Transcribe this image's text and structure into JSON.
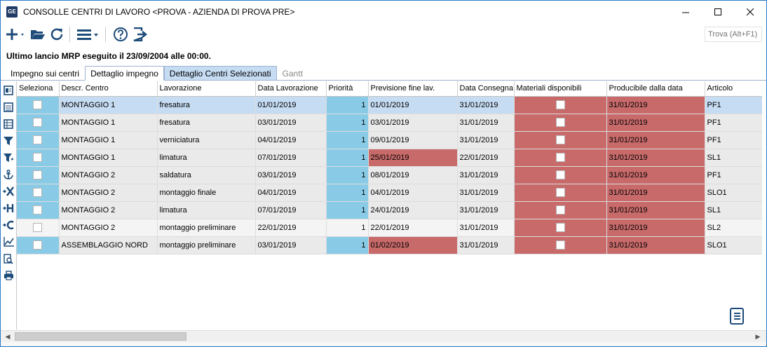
{
  "window": {
    "app_icon": "GE",
    "title": "CONSOLLE CENTRI DI LAVORO <PROVA - AZIENDA DI PROVA PRE>"
  },
  "toolbar": {
    "icons": [
      "plus-icon",
      "folder-open-icon",
      "refresh-icon",
      "menu-icon",
      "help-icon",
      "exit-icon"
    ],
    "search_placeholder": "Trova (Alt+F1)"
  },
  "status": {
    "mrp_line": "Ultimo lancio MRP eseguito il 23/09/2004 alle 00:00."
  },
  "tabs": [
    {
      "label": "Impegno sui centri",
      "state": "normal"
    },
    {
      "label": "Dettaglio impegno",
      "state": "active"
    },
    {
      "label": "Dettaglio Centri Selezionati",
      "state": "selected"
    },
    {
      "label": "Gantt",
      "state": "disabled"
    }
  ],
  "side_icons": [
    "form-icon",
    "list-icon",
    "table-icon",
    "filter-icon",
    "filter-plus-icon",
    "anchor-icon",
    "connect-x-icon",
    "connect-h-icon",
    "connect-c-icon",
    "chart-line-icon",
    "magnify-doc-icon",
    "print-icon"
  ],
  "grid": {
    "columns": [
      "Seleziona",
      "Descr. Centro",
      "Lavorazione",
      "Data Lavorazione",
      "Priorità",
      "Previsione fine lav.",
      "Data Consegna",
      "Materiali disponibili",
      "Producibile dalla data",
      "Articolo"
    ],
    "rows": [
      {
        "centro": "MONTAGGIO 1",
        "lavorazione": "fresatura",
        "data_lav": "01/01/2019",
        "priorita": "1",
        "previsione": "01/01/2019",
        "consegna": "31/01/2019",
        "producibile": "31/01/2019",
        "articolo": "PF1"
      },
      {
        "centro": "MONTAGGIO 1",
        "lavorazione": "fresatura",
        "data_lav": "03/01/2019",
        "priorita": "1",
        "previsione": "03/01/2019",
        "consegna": "31/01/2019",
        "producibile": "31/01/2019",
        "articolo": "PF1"
      },
      {
        "centro": "MONTAGGIO 1",
        "lavorazione": "verniciatura",
        "data_lav": "04/01/2019",
        "priorita": "1",
        "previsione": "09/01/2019",
        "consegna": "31/01/2019",
        "producibile": "31/01/2019",
        "articolo": "PF1"
      },
      {
        "centro": "MONTAGGIO 1",
        "lavorazione": "limatura",
        "data_lav": "07/01/2019",
        "priorita": "1",
        "previsione": "25/01/2019",
        "consegna": "22/01/2019",
        "producibile": "31/01/2019",
        "articolo": "SL1"
      },
      {
        "centro": "MONTAGGIO 2",
        "lavorazione": "saldatura",
        "data_lav": "03/01/2019",
        "priorita": "1",
        "previsione": "08/01/2019",
        "consegna": "31/01/2019",
        "producibile": "31/01/2019",
        "articolo": "PF1"
      },
      {
        "centro": "MONTAGGIO 2",
        "lavorazione": "montaggio finale",
        "data_lav": "04/01/2019",
        "priorita": "1",
        "previsione": "04/01/2019",
        "consegna": "31/01/2019",
        "producibile": "31/01/2019",
        "articolo": "SLO1"
      },
      {
        "centro": "MONTAGGIO 2",
        "lavorazione": "limatura",
        "data_lav": "07/01/2019",
        "priorita": "1",
        "previsione": "24/01/2019",
        "consegna": "31/01/2019",
        "producibile": "31/01/2019",
        "articolo": "SL1"
      },
      {
        "centro": "MONTAGGIO 2",
        "lavorazione": "montaggio preliminare",
        "data_lav": "22/01/2019",
        "priorita": "1",
        "previsione": "22/01/2019",
        "consegna": "31/01/2019",
        "producibile": "31/01/2019",
        "articolo": "SL2"
      },
      {
        "centro": "ASSEMBLAGGIO NORD",
        "lavorazione": "montaggio preliminare",
        "data_lav": "03/01/2019",
        "priorita": "1",
        "previsione": "01/02/2019",
        "consegna": "31/01/2019",
        "producibile": "31/01/2019",
        "articolo": "SLO1"
      }
    ]
  },
  "colors": {
    "selected_row": "#c6dcf3",
    "priority_cell": "#89cbe6",
    "alert_cell": "#c86a6a"
  }
}
